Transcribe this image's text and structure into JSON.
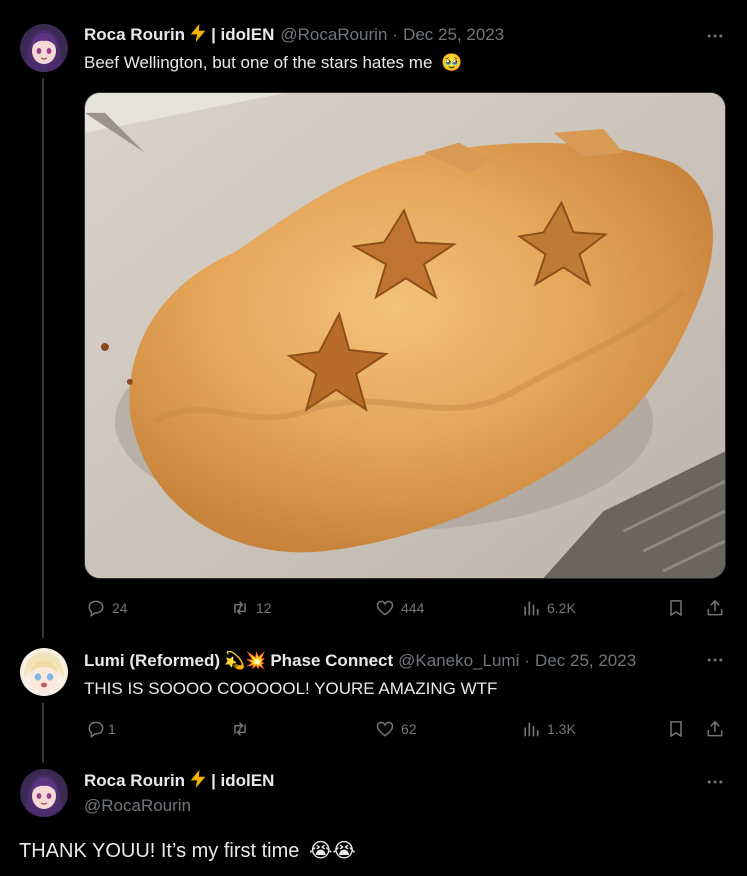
{
  "tweet1": {
    "author_name": "Roca Rourin",
    "author_suffix": "| idolEN",
    "handle": "@RocaRourin",
    "separator": "·",
    "date": "Dec 25, 2023",
    "text": "Beef Wellington, but one of the stars hates me",
    "text_emoji": "🥹",
    "image_alt": "Beef Wellington decorated with pastry stars",
    "stats": {
      "replies": "24",
      "reposts": "12",
      "likes": "444",
      "views": "6.2K"
    }
  },
  "tweet2": {
    "author_name": "Lumi (Reformed)",
    "author_emojis": "💫💥",
    "author_suffix": "Phase Connect",
    "handle": "@Kaneko_Lumi",
    "separator": "·",
    "date": "Dec 25, 2023",
    "text": "THIS IS SOOOO COOOOOL! YOURE AMAZING WTF",
    "stats": {
      "replies": "1",
      "reposts": "",
      "likes": "62",
      "views": "1.3K"
    }
  },
  "tweet3": {
    "author_name": "Roca Rourin",
    "author_suffix": "| idolEN",
    "handle": "@RocaRourin",
    "text": "THANK YOUU! It’s my first time",
    "text_emojis": "😭😭"
  },
  "icons": {
    "more": "more-horizontal-icon",
    "reply": "reply-icon",
    "repost": "repost-icon",
    "like": "heart-icon",
    "views": "views-icon",
    "bookmark": "bookmark-icon",
    "share": "share-icon",
    "lightning": "lightning-icon"
  },
  "colors": {
    "background": "#000000",
    "text_primary": "#e7e9ea",
    "text_secondary": "#71767b",
    "thread_line": "#333639",
    "lightning": "#f5b301"
  }
}
